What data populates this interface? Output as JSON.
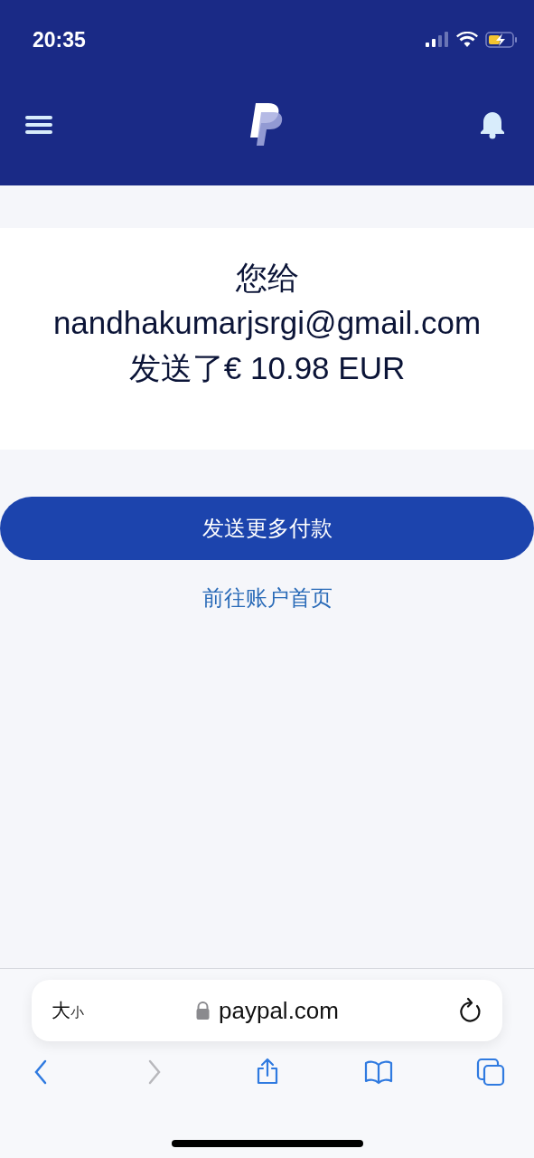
{
  "status_bar": {
    "time": "20:35",
    "battery_charging": true
  },
  "message": {
    "line_1": "您给",
    "recipient": "nandhakumarjsrgi@gmail.com",
    "line_3": "发送了€ 10.98 EUR"
  },
  "primary_button": "发送更多付款",
  "secondary_link": "前往账户首页",
  "browser": {
    "text_size": {
      "large": "大",
      "small": "小"
    },
    "url": "paypal.com",
    "toolbar": [
      {
        "kind": "back",
        "disabled": false
      },
      {
        "kind": "forward",
        "disabled": true
      },
      {
        "kind": "share",
        "disabled": false
      },
      {
        "kind": "bookmarks",
        "disabled": false
      },
      {
        "kind": "tabs",
        "disabled": false
      }
    ]
  }
}
